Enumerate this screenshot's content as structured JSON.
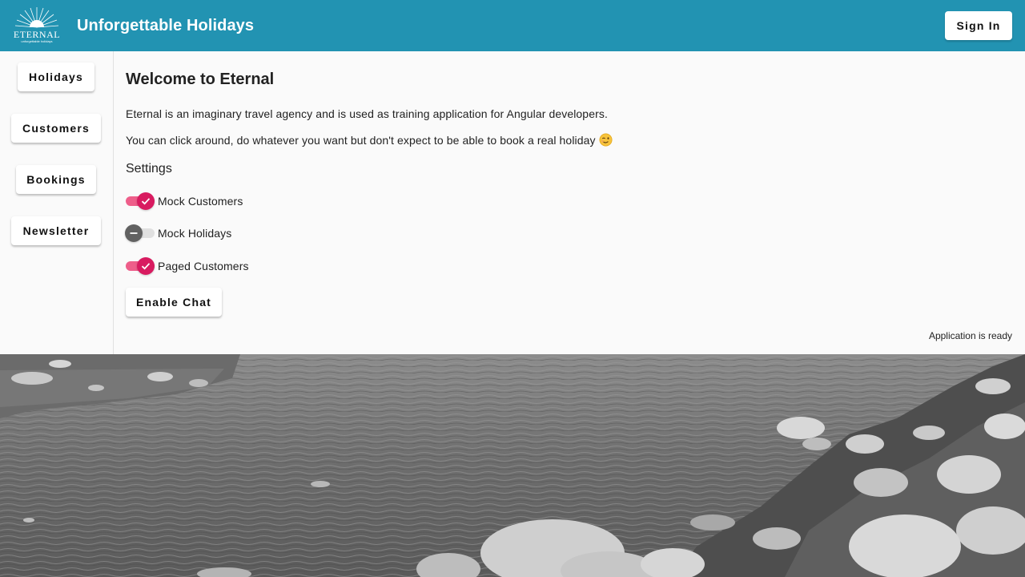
{
  "header": {
    "logo_text": "ETERNAL",
    "logo_subtext": "unforgettable holidays",
    "title": "Unforgettable Holidays",
    "sign_in_label": "Sign In"
  },
  "sidebar": {
    "items": [
      {
        "label": "Holidays"
      },
      {
        "label": "Customers"
      },
      {
        "label": "Bookings"
      },
      {
        "label": "Newsletter"
      }
    ]
  },
  "main": {
    "heading": "Welcome to Eternal",
    "intro": "Eternal is an imaginary travel agency and is used as training application for Angular developers.",
    "note": "You can click around, do whatever you want but don't expect to be able to book a real holiday",
    "settings_heading": "Settings",
    "toggles": [
      {
        "label": "Mock Customers",
        "checked": true
      },
      {
        "label": "Mock Holidays",
        "checked": false
      },
      {
        "label": "Paged Customers",
        "checked": true
      }
    ],
    "enable_chat_label": "Enable Chat",
    "status": "Application is ready"
  },
  "colors": {
    "toolbar": "#2293b2",
    "toggle_on": "#d81b60",
    "toggle_on_track": "#ee5e8a",
    "toggle_off": "#616161"
  },
  "icons": {
    "logo": "sunrise-logo-icon",
    "note_emoji": "winking-face-icon",
    "toggle_on": "check-icon",
    "toggle_off": "minus-icon"
  }
}
